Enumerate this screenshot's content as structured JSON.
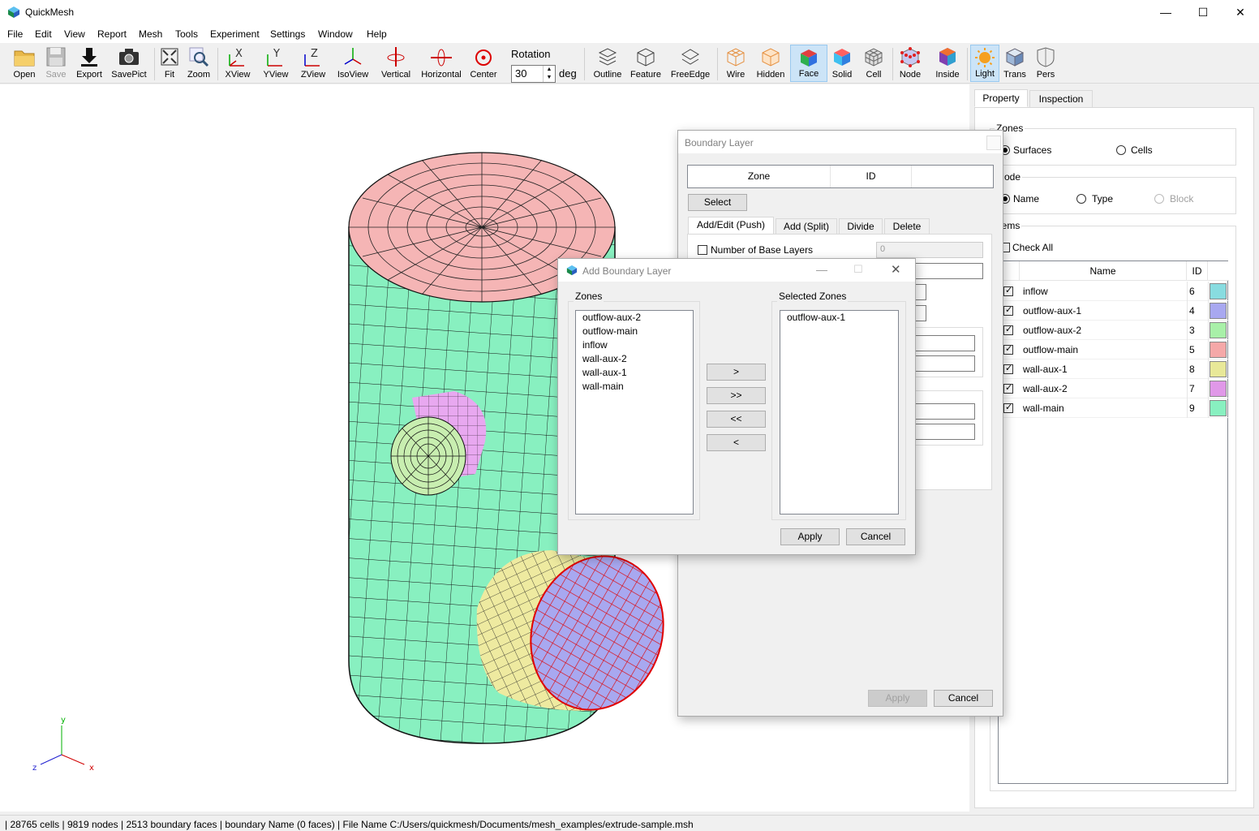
{
  "app": {
    "title": "QuickMesh"
  },
  "menu": [
    "File",
    "Edit",
    "View",
    "Report",
    "Mesh",
    "Tools",
    "Experiment",
    "Settings",
    "Window",
    "Help"
  ],
  "toolbar": {
    "open": "Open",
    "save": "Save",
    "export": "Export",
    "savepict": "SavePict",
    "fit": "Fit",
    "zoom": "Zoom",
    "xview": "XView",
    "yview": "YView",
    "zview": "ZView",
    "isoview": "IsoView",
    "vertical": "Vertical",
    "horizontal": "Horizontal",
    "center": "Center",
    "rotation_label": "Rotation",
    "rotation_value": "30",
    "rotation_unit": "deg",
    "outline": "Outline",
    "feature": "Feature",
    "freeedge": "FreeEdge",
    "wire": "Wire",
    "hidden": "Hidden",
    "face": "Face",
    "solid": "Solid",
    "cell": "Cell",
    "node": "Node",
    "inside": "Inside",
    "light": "Light",
    "trans": "Trans",
    "pers": "Pers"
  },
  "axes": {
    "x": "x",
    "y": "y",
    "z": "z"
  },
  "right_panel": {
    "tabs": [
      "Property",
      "Inspection"
    ],
    "zones_group": "Zones",
    "surfaces": "Surfaces",
    "cells": "Cells",
    "mode_group": "Mode",
    "name": "Name",
    "type": "Type",
    "block": "Block",
    "items_group": "Items",
    "check_all": "Check All",
    "col_name": "Name",
    "col_id": "ID",
    "items": [
      {
        "name": "inflow",
        "id": "6",
        "color": "#88dce0"
      },
      {
        "name": "outflow-aux-1",
        "id": "4",
        "color": "#a8a8f0"
      },
      {
        "name": "outflow-aux-2",
        "id": "3",
        "color": "#a8f0a8"
      },
      {
        "name": "outflow-main",
        "id": "5",
        "color": "#f5a8a8"
      },
      {
        "name": "wall-aux-1",
        "id": "8",
        "color": "#e8e898"
      },
      {
        "name": "wall-aux-2",
        "id": "7",
        "color": "#e098e8"
      },
      {
        "name": "wall-main",
        "id": "9",
        "color": "#88f0c0"
      }
    ]
  },
  "boundary_dialog": {
    "title": "Boundary Layer",
    "col_zone": "Zone",
    "col_id": "ID",
    "select": "Select",
    "tabs": [
      "Add/Edit (Push)",
      "Add (Split)",
      "Divide",
      "Delete"
    ],
    "base_layers_label": "Number of Base Layers",
    "base_layers_value": "0",
    "apply": "Apply",
    "cancel": "Cancel"
  },
  "add_dialog": {
    "title": "Add Boundary Layer",
    "zones_label": "Zones",
    "selected_label": "Selected Zones",
    "zones": [
      "outflow-aux-2",
      "outflow-main",
      "inflow",
      "wall-aux-2",
      "wall-aux-1",
      "wall-main"
    ],
    "selected": [
      "outflow-aux-1"
    ],
    "move_right": ">",
    "move_all_right": ">>",
    "move_all_left": "<<",
    "move_left": "<",
    "apply": "Apply",
    "cancel": "Cancel"
  },
  "status": "| 28765 cells | 9819 nodes | 2513 boundary faces |  boundary Name  (0 faces) | File Name C:/Users/quickmesh/Documents/mesh_examples/extrude-sample.msh"
}
